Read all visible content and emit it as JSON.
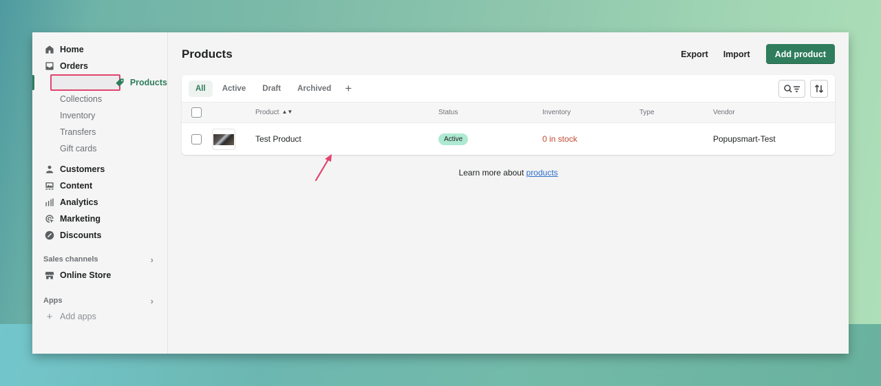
{
  "sidebar": {
    "items": [
      {
        "label": "Home",
        "icon": "home-icon"
      },
      {
        "label": "Orders",
        "icon": "orders-icon"
      },
      {
        "label": "Products",
        "icon": "tag-icon",
        "active": true
      }
    ],
    "product_sub": [
      "Collections",
      "Inventory",
      "Transfers",
      "Gift cards"
    ],
    "items2": [
      {
        "label": "Customers",
        "icon": "person-icon"
      },
      {
        "label": "Content",
        "icon": "content-icon"
      },
      {
        "label": "Analytics",
        "icon": "bar-chart-icon"
      },
      {
        "label": "Marketing",
        "icon": "target-icon"
      },
      {
        "label": "Discounts",
        "icon": "discount-icon"
      }
    ],
    "sales_channels": {
      "heading": "Sales channels",
      "items": [
        {
          "label": "Online Store",
          "icon": "store-icon"
        }
      ]
    },
    "apps": {
      "heading": "Apps",
      "add_label": "Add apps"
    }
  },
  "header": {
    "title": "Products",
    "export_label": "Export",
    "import_label": "Import",
    "add_label": "Add product"
  },
  "tabs": [
    "All",
    "Active",
    "Draft",
    "Archived"
  ],
  "table": {
    "columns": {
      "product": "Product",
      "status": "Status",
      "inventory": "Inventory",
      "type": "Type",
      "vendor": "Vendor"
    },
    "rows": [
      {
        "product": "Test Product",
        "status": "Active",
        "inventory": "0 in stock",
        "type": "",
        "vendor": "Popupsmart-Test"
      }
    ]
  },
  "footer": {
    "learn_prefix": "Learn more about ",
    "learn_link": "products"
  },
  "colors": {
    "accent": "#2f7d5d",
    "highlight": "#e0446e",
    "badge": "#aee9d1",
    "stock": "#c0492f"
  }
}
